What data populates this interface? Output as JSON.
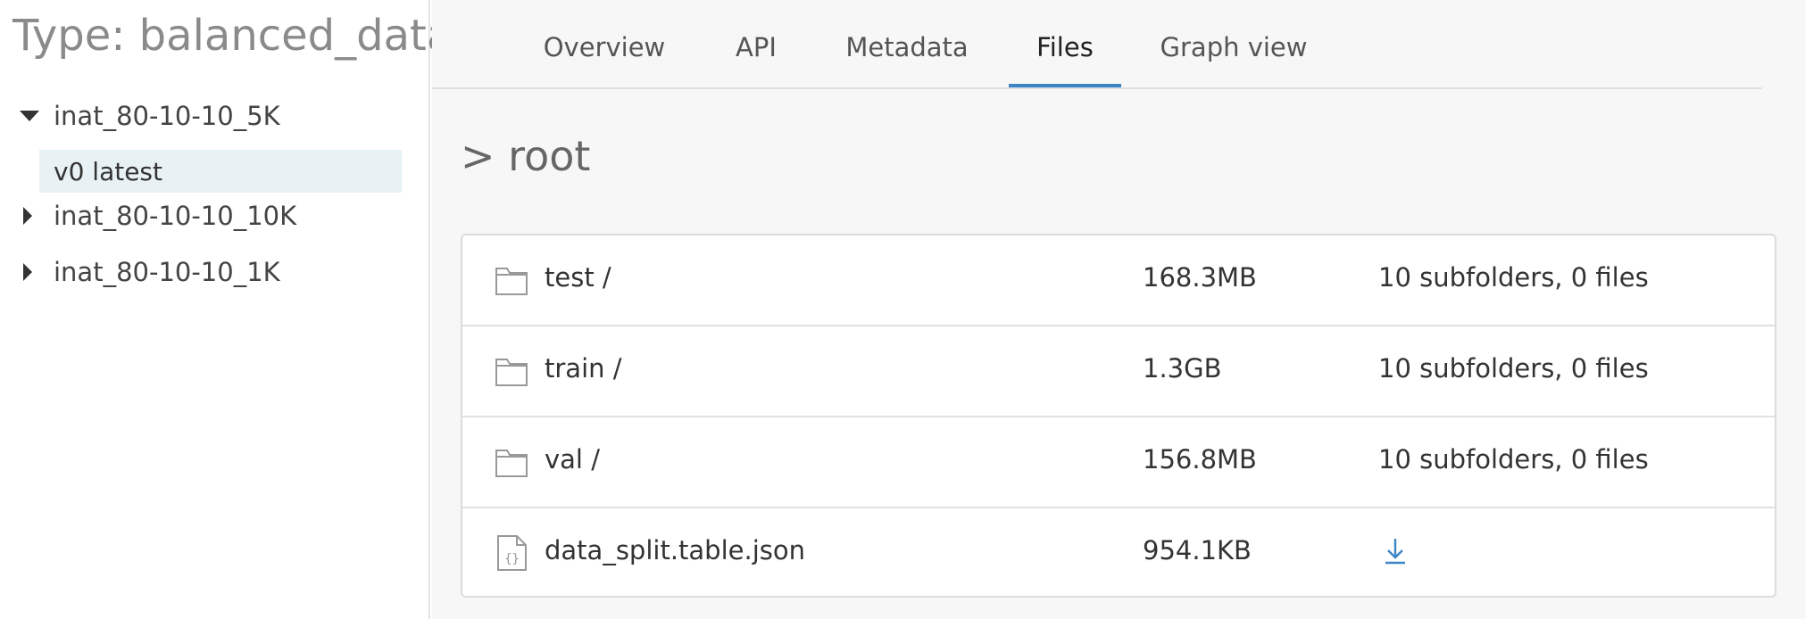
{
  "sidebar": {
    "title": "Type: balanced_data",
    "items": [
      {
        "label": "inat_80-10-10_5K",
        "expanded": true,
        "versions": [
          {
            "label": "v0 latest",
            "selected": true
          }
        ]
      },
      {
        "label": "inat_80-10-10_10K",
        "expanded": false
      },
      {
        "label": "inat_80-10-10_1K",
        "expanded": false
      }
    ]
  },
  "tabs": [
    {
      "label": "Overview"
    },
    {
      "label": "API"
    },
    {
      "label": "Metadata"
    },
    {
      "label": "Files",
      "active": true
    },
    {
      "label": "Graph view"
    }
  ],
  "breadcrumb": "> root",
  "files": [
    {
      "name": "test /",
      "size": "168.3MB",
      "info": "10 subfolders, 0 files",
      "icon": "folder-icon"
    },
    {
      "name": "train /",
      "size": "1.3GB",
      "info": "10 subfolders, 0 files",
      "icon": "folder-icon"
    },
    {
      "name": "val /",
      "size": "156.8MB",
      "info": "10 subfolders, 0 files",
      "icon": "folder-icon"
    },
    {
      "name": "data_split.table.json",
      "size": "954.1KB",
      "info": "",
      "icon": "json-file-icon",
      "action": "download-icon"
    }
  ],
  "colors": {
    "accent": "#3a85c5",
    "selected_bg": "#e8f1f4",
    "main_bg": "#f7f7f7"
  }
}
